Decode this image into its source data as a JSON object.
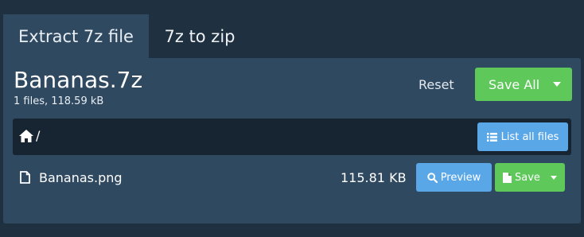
{
  "tabs": [
    {
      "label": "Extract 7z file",
      "active": true
    },
    {
      "label": "7z to zip",
      "active": false
    }
  ],
  "archive": {
    "name": "Bananas.7z",
    "meta": "1 files, 118.59 kB"
  },
  "toolbar": {
    "reset_label": "Reset",
    "save_all_label": "Save All"
  },
  "path": {
    "current": "/",
    "list_all_label": "List all files"
  },
  "files": [
    {
      "name": "Bananas.png",
      "size": "115.81 KB",
      "preview_label": "Preview",
      "save_label": "Save"
    }
  ],
  "icons": {
    "home": "home-icon",
    "list": "list-icon",
    "file": "file-icon",
    "search": "search-icon",
    "save_file": "save-file-icon",
    "caret": "caret-down-icon"
  },
  "colors": {
    "page_background": "#1f3040",
    "panel": "#2f4961",
    "path_bar": "#172431",
    "green_button": "#5ec95a",
    "blue_button": "#5aa7e8"
  }
}
